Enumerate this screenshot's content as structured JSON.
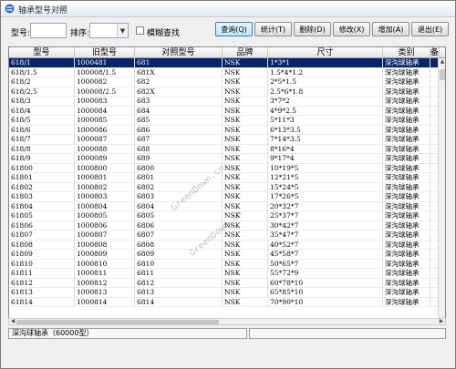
{
  "window": {
    "title": "轴承型号对照"
  },
  "toolbar": {
    "model_label": "型号:",
    "model_value": "",
    "sort_label": "排序:",
    "sort_value": "",
    "fuzzy_label": "模糊查找",
    "buttons": [
      "查询(Q)",
      "统计(T)",
      "删除(D)",
      "修改(X)",
      "增加(A)",
      "退出(E)"
    ]
  },
  "table": {
    "headers": [
      "型号",
      "旧型号",
      "对照型号",
      "品牌",
      "尺寸",
      "类别",
      "备"
    ],
    "rows": [
      [
        "618/1",
        "1000481",
        "681",
        "NSK",
        "1*3*1",
        "深沟球轴承"
      ],
      [
        "618/1.5",
        "100008/1.5",
        "681X",
        "NSK",
        "1.5*4*1.2",
        "深沟球轴承"
      ],
      [
        "618/2",
        "1000082",
        "682",
        "NSK",
        "2*5*1.5",
        "深沟球轴承"
      ],
      [
        "618/2.5",
        "100008/2.5",
        "682X",
        "NSK",
        "2.5*6*1.8",
        "深沟球轴承"
      ],
      [
        "618/3",
        "1000083",
        "683",
        "NSK",
        "3*7*2",
        "深沟球轴承"
      ],
      [
        "618/4",
        "1000084",
        "684",
        "NSK",
        "4*9*2.5",
        "深沟球轴承"
      ],
      [
        "618/5",
        "1000085",
        "685",
        "NSK",
        "5*11*3",
        "深沟球轴承"
      ],
      [
        "618/6",
        "1000086",
        "686",
        "NSK",
        "6*13*3.5",
        "深沟球轴承"
      ],
      [
        "618/7",
        "1000087",
        "687",
        "NSK",
        "7*14*3.5",
        "深沟球轴承"
      ],
      [
        "618/8",
        "1000088",
        "688",
        "NSK",
        "8*16*4",
        "深沟球轴承"
      ],
      [
        "618/9",
        "1000089",
        "689",
        "NSK",
        "9*17*4",
        "深沟球轴承"
      ],
      [
        "61800",
        "1000800",
        "6800",
        "NSK",
        "10*19*5",
        "深沟球轴承"
      ],
      [
        "61801",
        "1000801",
        "6801",
        "NSK",
        "12*21*5",
        "深沟球轴承"
      ],
      [
        "61802",
        "1000802",
        "6802",
        "NSK",
        "15*24*5",
        "深沟球轴承"
      ],
      [
        "61803",
        "1000803",
        "6803",
        "NSK",
        "17*26*5",
        "深沟球轴承"
      ],
      [
        "61804",
        "1000804",
        "6804",
        "NSK",
        "20*32*7",
        "深沟球轴承"
      ],
      [
        "61805",
        "1000805",
        "6805",
        "NSK",
        "25*37*7",
        "深沟球轴承"
      ],
      [
        "61806",
        "1000806",
        "6806",
        "NSK",
        "30*42*7",
        "深沟球轴承"
      ],
      [
        "61807",
        "1000807",
        "6807",
        "NSK",
        "35*47*7",
        "深沟球轴承"
      ],
      [
        "61808",
        "1000808",
        "6808",
        "NSK",
        "40*52*7",
        "深沟球轴承"
      ],
      [
        "61809",
        "1000809",
        "6809",
        "NSK",
        "45*58*7",
        "深沟球轴承"
      ],
      [
        "61810",
        "1000810",
        "6810",
        "NSK",
        "50*65*7",
        "深沟球轴承"
      ],
      [
        "61811",
        "1000811",
        "6811",
        "NSK",
        "55*72*9",
        "深沟球轴承"
      ],
      [
        "61812",
        "1000812",
        "6812",
        "NSK",
        "60*78*10",
        "深沟球轴承"
      ],
      [
        "61813",
        "1000813",
        "6813",
        "NSK",
        "65*85*10",
        "深沟球轴承"
      ],
      [
        "61814",
        "1000814",
        "6814",
        "NSK",
        "70*90*10",
        "深沟球轴承"
      ]
    ],
    "selected_row": 0
  },
  "status": {
    "left_text": "深沟球轴承（60000型）",
    "right_text": ""
  },
  "watermark": {
    "text": "GreenDown.cn"
  },
  "colors": {
    "selection": "#0a246a",
    "title_bg": "#e6e9ee"
  }
}
